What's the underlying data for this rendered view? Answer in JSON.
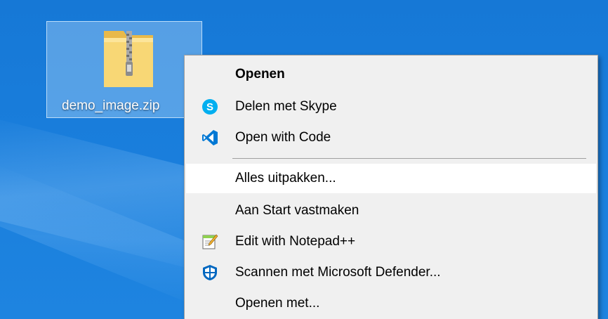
{
  "desktop": {
    "icon": {
      "label": "demo_image.zip",
      "icon_name": "zip-folder-icon"
    }
  },
  "context_menu": {
    "items": [
      {
        "label": "Openen",
        "bold": true,
        "icon": null
      },
      {
        "label": "Delen met Skype",
        "icon": "skype-icon"
      },
      {
        "label": "Open with Code",
        "icon": "vscode-icon"
      },
      {
        "label": "Alles uitpakken...",
        "icon": null,
        "highlighted": true
      },
      {
        "label": "Aan Start vastmaken",
        "icon": null
      },
      {
        "label": "Edit with Notepad++",
        "icon": "notepad-plus-plus-icon"
      },
      {
        "label": "Scannen met Microsoft Defender...",
        "icon": "defender-shield-icon"
      },
      {
        "label": "Openen met...",
        "icon": null
      }
    ]
  },
  "colors": {
    "desktop_blue": "#1678d6",
    "menu_background": "#f0f0f0",
    "menu_hover": "#ffffff",
    "skype_blue": "#00aff0",
    "vscode_blue": "#0078d4",
    "defender_blue": "#0067c0"
  }
}
